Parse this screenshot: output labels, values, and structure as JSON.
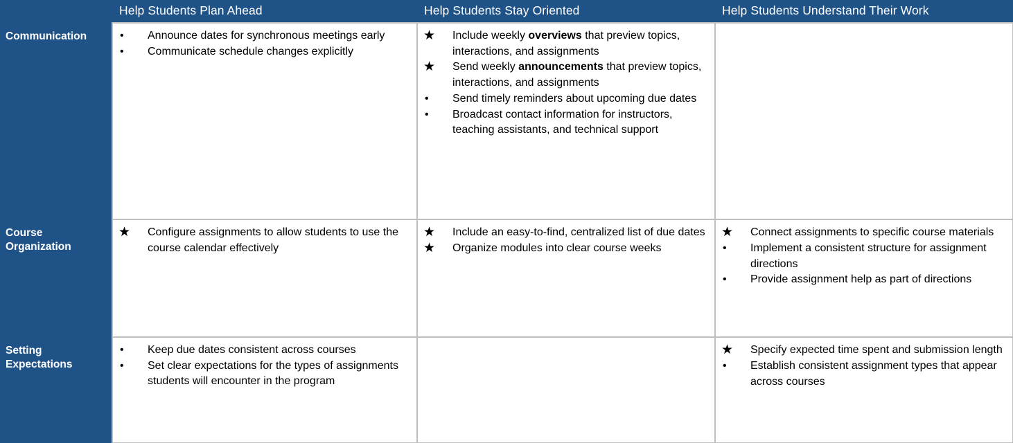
{
  "header": {
    "corner_label": "",
    "columns": [
      "Help Students Plan Ahead",
      "Help Students Stay Oriented",
      "Help Students Understand Their Work"
    ]
  },
  "colors": {
    "header_blue": "#1f5286",
    "cell_border": "#bfbfbf",
    "cell_background": "#ffffff",
    "header_text": "#ffffff",
    "body_text": "#000000",
    "watermark": "#f4f5f9"
  },
  "markers": {
    "bullet": "•",
    "star": "★"
  },
  "rows": [
    {
      "label": "Communication",
      "cells": [
        {
          "items": [
            {
              "marker": "bullet",
              "text": "Announce dates for synchronous meetings early"
            },
            {
              "marker": "bullet",
              "text": "Communicate schedule changes explicitly"
            }
          ]
        },
        {
          "items": [
            {
              "marker": "star",
              "text": "Include weekly overviews that preview topics, interactions, and assignments",
              "bold": "overviews"
            },
            {
              "marker": "star",
              "text": "Send weekly announcements that preview topics, interactions, and assignments",
              "bold": "announcements"
            },
            {
              "marker": "bullet",
              "text": "Send timely reminders about upcoming due dates"
            },
            {
              "marker": "bullet",
              "text": "Broadcast contact information for instructors, teaching assistants, and technical support"
            }
          ]
        },
        {
          "items": []
        }
      ]
    },
    {
      "label": "Course Organization",
      "cells": [
        {
          "items": [
            {
              "marker": "star",
              "text": "Configure assignments to allow students to use the course calendar effectively"
            }
          ]
        },
        {
          "items": [
            {
              "marker": "star",
              "text": "Include an easy-to-find, centralized list of due dates"
            },
            {
              "marker": "star",
              "text": "Organize modules into clear course weeks"
            }
          ]
        },
        {
          "items": [
            {
              "marker": "star",
              "text": "Connect assignments to specific course materials"
            },
            {
              "marker": "bullet",
              "text": "Implement a consistent structure for assignment directions"
            },
            {
              "marker": "bullet",
              "text": "Provide assignment help as part of directions"
            }
          ]
        }
      ]
    },
    {
      "label": "Setting Expectations",
      "cells": [
        {
          "items": [
            {
              "marker": "bullet",
              "text": "Keep due dates consistent across courses"
            },
            {
              "marker": "bullet",
              "text": "Set clear expectations for the types of assignments students will encounter in the program"
            }
          ]
        },
        {
          "items": []
        },
        {
          "items": [
            {
              "marker": "star",
              "text": "Specify expected time spent and submission length"
            },
            {
              "marker": "bullet",
              "text": "Establish consistent assignment types that appear across courses"
            }
          ]
        }
      ]
    }
  ]
}
